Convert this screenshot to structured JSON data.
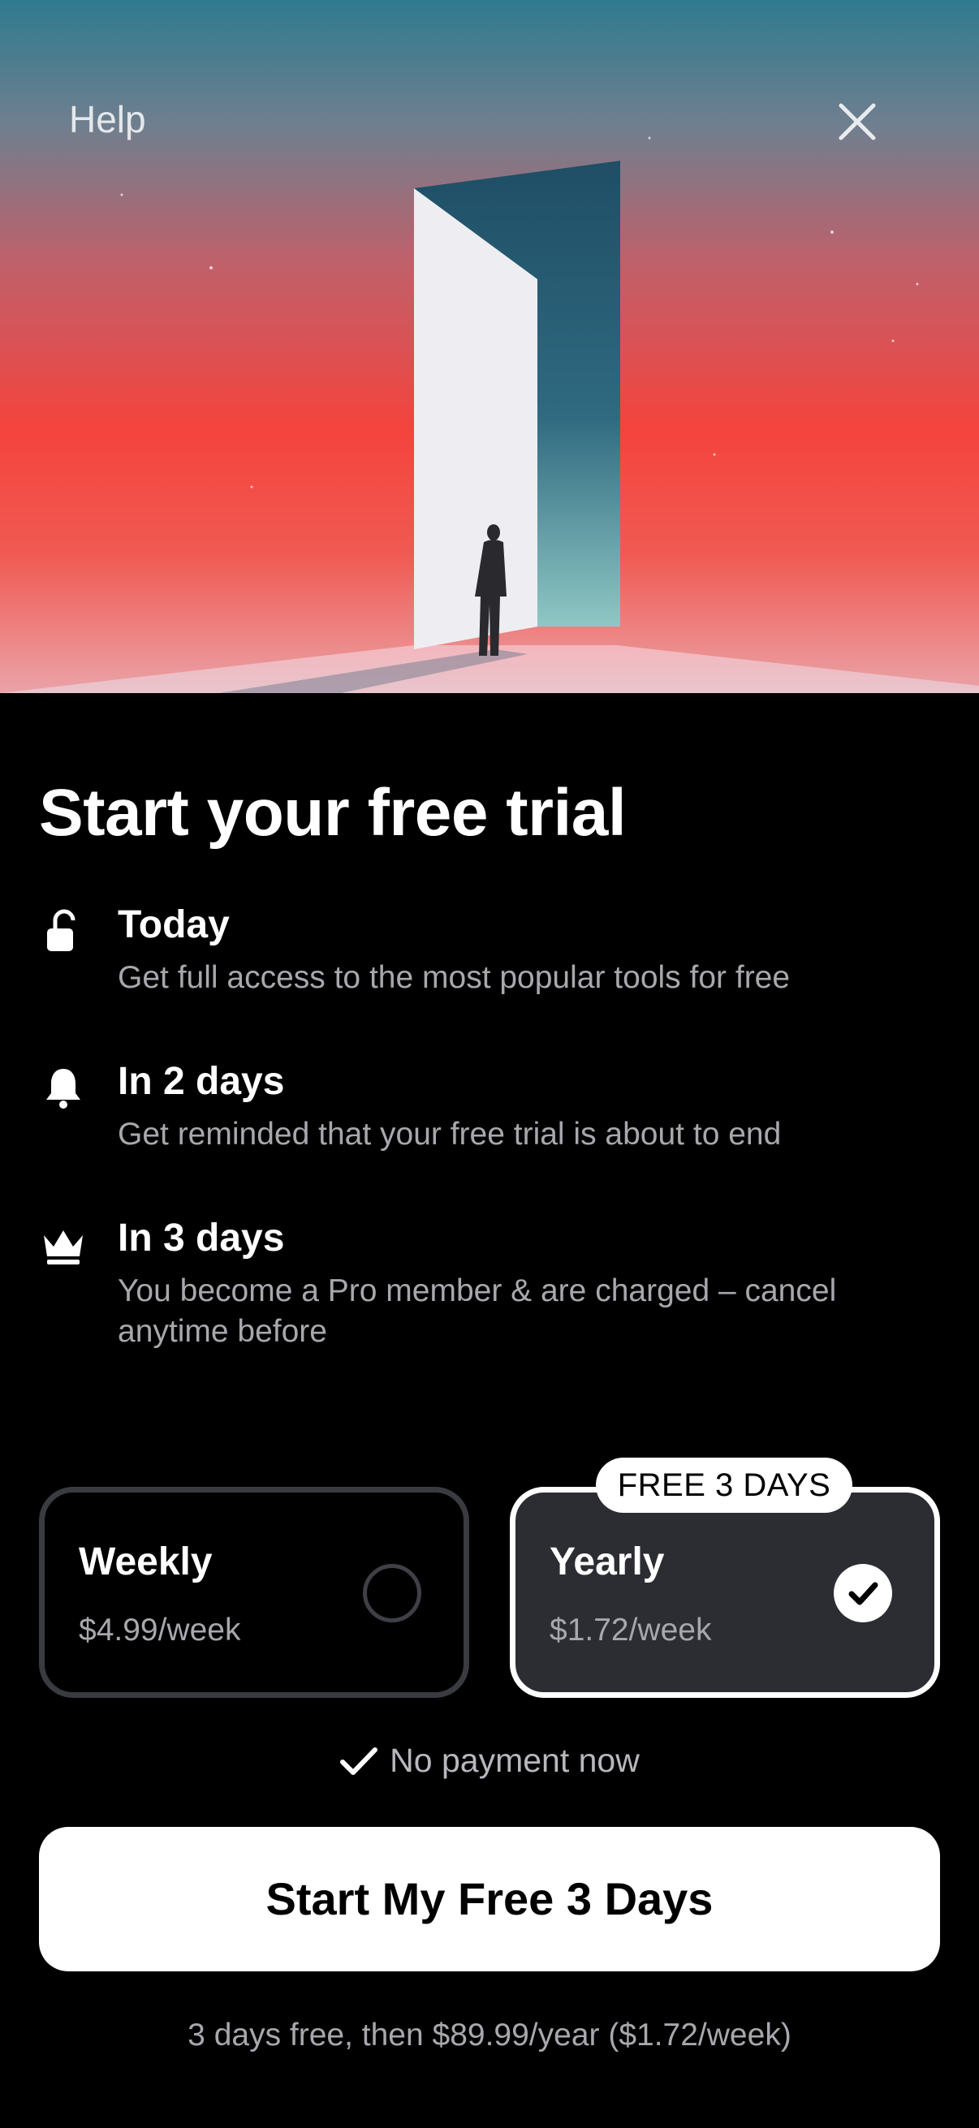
{
  "header": {
    "help_label": "Help",
    "close_icon": "close-icon"
  },
  "hero": {
    "image": "doorway-silhouette-illustration"
  },
  "title": "Start your free trial",
  "steps": [
    {
      "icon": "unlock-icon",
      "title": "Today",
      "description": "Get full access to the most popular tools for free"
    },
    {
      "icon": "bell-icon",
      "title": "In 2 days",
      "description": "Get reminded that your free trial is about to end"
    },
    {
      "icon": "crown-icon",
      "title": "In 3 days",
      "description": "You become a Pro member & are charged – cancel anytime before"
    }
  ],
  "plans": [
    {
      "name": "Weekly",
      "price": "$4.99/week",
      "selected": false
    },
    {
      "name": "Yearly",
      "price": "$1.72/week",
      "selected": true,
      "badge": "FREE 3 DAYS"
    }
  ],
  "no_payment_label": "No payment now",
  "cta_label": "Start My Free 3 Days",
  "terms": "3 days free, then $89.99/year ($1.72/week)",
  "colors": {
    "background": "#000000",
    "selected_card": "#2c2d33",
    "muted_text": "#a7a7ad"
  }
}
